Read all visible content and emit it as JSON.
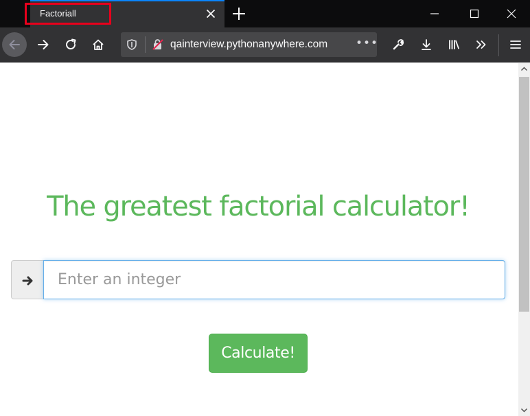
{
  "browser": {
    "tab": {
      "title": "Factoriall"
    },
    "url": "qainterview.pythonanywhere.com",
    "page_actions_glyph": "•••"
  },
  "page": {
    "heading": "The greatest factorial calculator!",
    "input": {
      "placeholder": "Enter an integer",
      "value": ""
    },
    "calculate_label": "Calculate!"
  },
  "colors": {
    "accent": "#5cb85c",
    "tab_indicator": "#0a84ff",
    "highlight_box": "#e8001c"
  }
}
